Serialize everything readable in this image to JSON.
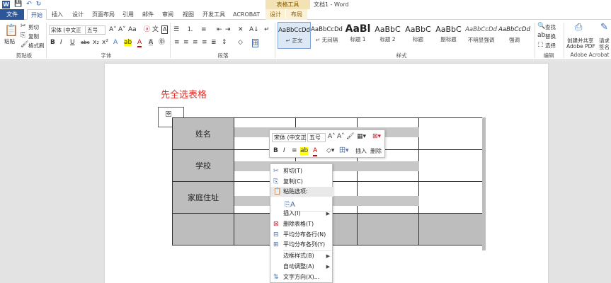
{
  "titlebar": {
    "qat_save": "💾",
    "qat_undo": "↶",
    "qat_redo": "↻",
    "context_group": "表格工具",
    "doc_title": "文档1 - Word"
  },
  "tabs": {
    "file": "文件",
    "items": [
      "开始",
      "插入",
      "设计",
      "页面布局",
      "引用",
      "邮件",
      "审阅",
      "视图",
      "开发工具",
      "ACROBAT",
      "设计",
      "布局"
    ]
  },
  "ribbon": {
    "clipboard": {
      "paste": "粘贴",
      "cut": "剪切",
      "copy": "复制",
      "format_painter": "格式刷",
      "label": "剪贴板"
    },
    "font": {
      "name": "宋体 (中文正",
      "size": "五号",
      "label": "字体",
      "bold": "B",
      "italic": "I",
      "underline": "U"
    },
    "paragraph": {
      "label": "段落"
    },
    "styles": {
      "label": "样式",
      "items": [
        {
          "sample": "AaBbCcDd",
          "name": "↵ 正文"
        },
        {
          "sample": "AaBbCcDd",
          "name": "↵ 无间隔"
        },
        {
          "sample": "AaBl",
          "name": "标题 1"
        },
        {
          "sample": "AaBbC",
          "name": "标题 2"
        },
        {
          "sample": "AaBbC",
          "name": "标题"
        },
        {
          "sample": "AaBbC",
          "name": "副标题"
        },
        {
          "sample": "AaBbCcDd",
          "name": "不明显强调"
        },
        {
          "sample": "AaBbCcDd",
          "name": "强调"
        }
      ]
    },
    "editing": {
      "find": "查找",
      "replace": "替换",
      "select": "选择",
      "label": "编辑"
    },
    "acrobat": {
      "create": "创建并共享",
      "create2": "Adobe PDF",
      "request": "请求",
      "request2": "签名",
      "label": "Adobe Acrobat"
    }
  },
  "document": {
    "heading": "先全选表格",
    "rows": [
      "姓名",
      "学校",
      "家庭住址",
      ""
    ]
  },
  "minitoolbar": {
    "font": "宋体 (中文正",
    "size": "五号",
    "insert": "插入",
    "delete": "删除"
  },
  "context_menu": {
    "items": [
      "剪切(T)",
      "复制(C)",
      "粘贴选项:",
      "",
      "插入(I)",
      "删除表格(T)",
      "平均分布各行(N)",
      "平均分布各列(Y)",
      "边框样式(B)",
      "自动调整(A)",
      "文字方向(X)..."
    ]
  }
}
